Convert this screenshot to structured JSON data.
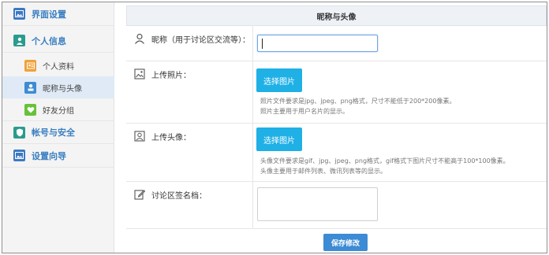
{
  "sidebar": {
    "items": [
      {
        "label": "界面设置",
        "icon": "image-icon"
      },
      {
        "label": "个人信息",
        "icon": "user-icon"
      },
      {
        "label": "个人资料",
        "icon": "profile-card-icon"
      },
      {
        "label": "昵称与头像",
        "icon": "avatar-icon"
      },
      {
        "label": "好友分组",
        "icon": "heart-icon"
      },
      {
        "label": "帐号与安全",
        "icon": "shield-icon"
      },
      {
        "label": "设置向导",
        "icon": "guide-icon"
      }
    ]
  },
  "main": {
    "title": "昵称与头像",
    "nickname": {
      "label": "昵称（用于讨论区交流等）：",
      "value": ""
    },
    "photo": {
      "label": "上传照片：",
      "button": "选择图片",
      "hint1": "照片文件要求是jpg、jpeg、png格式，尺寸不能低于200*200像素。",
      "hint2": "照片主要用于用户名片的显示。"
    },
    "avatar": {
      "label": "上传头像：",
      "button": "选择图片",
      "hint1": "头像文件要求是gif、jpg、jpeg、png格式，gif格式下图片尺寸不能高于100*100像素。",
      "hint2": "头像主要用于邮件列表、微讯列表等的显示。"
    },
    "signature": {
      "label": "讨论区签名档：",
      "value": ""
    },
    "save_button": "保存修改"
  },
  "colors": {
    "accent": "#3d8bd4",
    "select_button": "#1fb0e6",
    "active_nav": "#dfeaf6"
  }
}
